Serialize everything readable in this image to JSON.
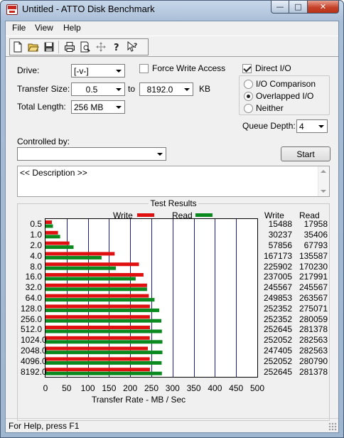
{
  "window": {
    "title": "Untitled - ATTO Disk Benchmark",
    "controls": {
      "minimize": "—",
      "maximize": "□",
      "close": "✕"
    }
  },
  "menu": [
    "File",
    "View",
    "Help"
  ],
  "toolbar": {
    "buttons": [
      "new-file-icon",
      "open-folder-icon",
      "save-icon",
      "print-icon",
      "print-preview-icon",
      "move-icon",
      "help-icon",
      "context-help-icon"
    ]
  },
  "settings": {
    "drive_label": "Drive:",
    "drive_value": "[-v-]",
    "force_write_label": "Force Write Access",
    "force_write_checked": false,
    "direct_io_label": "Direct I/O",
    "direct_io_checked": true,
    "transfer_size_label": "Transfer Size:",
    "transfer_from": "0.5",
    "to_label": "to",
    "transfer_to": "8192.0",
    "kb_label": "KB",
    "total_length_label": "Total Length:",
    "total_length_value": "256 MB",
    "io_modes": [
      {
        "label": "I/O Comparison",
        "checked": false
      },
      {
        "label": "Overlapped I/O",
        "checked": true
      },
      {
        "label": "Neither",
        "checked": false
      }
    ],
    "queue_depth_label": "Queue Depth:",
    "queue_depth_value": "4",
    "controlled_by_label": "Controlled by:",
    "controlled_by_value": "",
    "start_label": "Start",
    "description": "<< Description >>"
  },
  "results": {
    "title": "Test Results",
    "write_legend": "Write",
    "read_legend": "Read",
    "write_header": "Write",
    "read_header": "Read",
    "write_color": "#e01010",
    "read_color": "#0a8a1e"
  },
  "chart_data": {
    "type": "bar",
    "orientation": "horizontal",
    "xlabel": "Transfer Rate - MB / Sec",
    "xlim": [
      0,
      500
    ],
    "xticks": [
      "0",
      "50",
      "100",
      "150",
      "200",
      "250",
      "300",
      "350",
      "400",
      "450",
      "500"
    ],
    "grid": true,
    "categories": [
      "0.5",
      "1.0",
      "2.0",
      "4.0",
      "8.0",
      "16.0",
      "32.0",
      "64.0",
      "128.0",
      "256.0",
      "512.0",
      "1024.0",
      "2048.0",
      "4096.0",
      "8192.0"
    ],
    "series": [
      {
        "name": "Write",
        "values": [
          15488,
          30237,
          57856,
          167173,
          225902,
          237005,
          245567,
          249853,
          252352,
          252352,
          252645,
          252052,
          247405,
          252052,
          252645
        ]
      },
      {
        "name": "Read",
        "values": [
          17958,
          35406,
          67793,
          135587,
          170230,
          217991,
          245567,
          263567,
          275071,
          280059,
          281378,
          282563,
          282563,
          280790,
          281378
        ]
      }
    ]
  },
  "status": {
    "text": "For Help, press F1"
  }
}
